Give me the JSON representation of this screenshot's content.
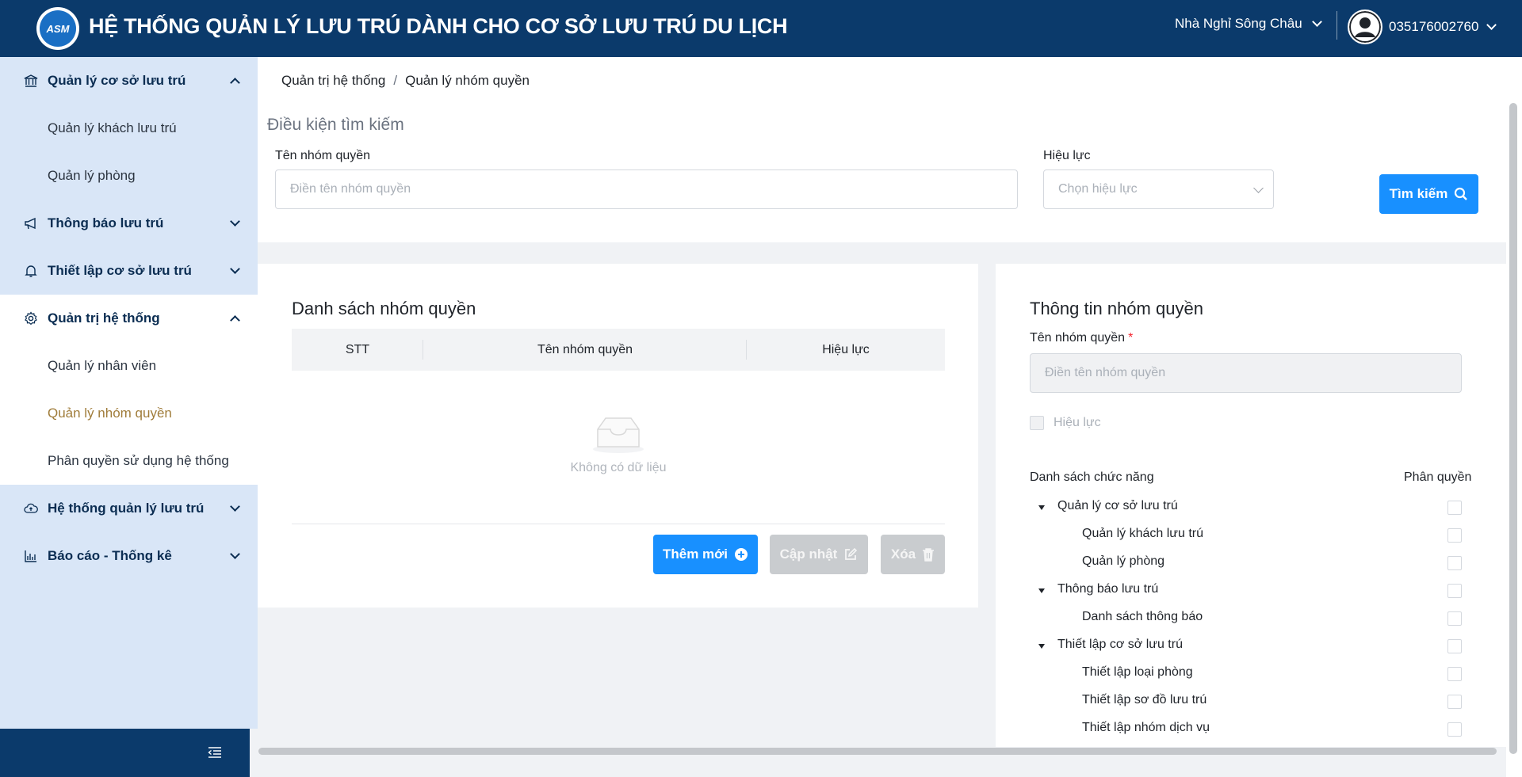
{
  "header": {
    "logo_text": "ASM",
    "title": "HỆ THỐNG QUẢN LÝ LƯU TRÚ DÀNH CHO CƠ SỞ LƯU TRÚ DU LỊCH",
    "facility": "Nhà Nghỉ Sông Châu",
    "user_phone": "035176002760"
  },
  "sidebar": {
    "items": [
      {
        "label": "Quản lý cơ sở lưu trú",
        "icon": "bank-icon",
        "expanded": true
      },
      {
        "label": "Quản lý khách lưu trú"
      },
      {
        "label": "Quản lý phòng"
      },
      {
        "label": "Thông báo lưu trú",
        "icon": "megaphone-icon",
        "expanded": false
      },
      {
        "label": "Thiết lập cơ sở lưu trú",
        "icon": "bell-icon",
        "expanded": false
      },
      {
        "label": "Quản trị hệ thống",
        "icon": "gear-icon",
        "expanded": true
      },
      {
        "label": "Quản lý nhân viên"
      },
      {
        "label": "Quản lý nhóm quyền",
        "active": true
      },
      {
        "label": "Phân quyền sử dụng hệ thống"
      },
      {
        "label": "Hệ thống quản lý lưu trú",
        "icon": "cloud-icon",
        "expanded": false
      },
      {
        "label": "Báo cáo - Thống kê",
        "icon": "bar-chart-icon",
        "expanded": false
      }
    ]
  },
  "breadcrumb": {
    "parent": "Quản trị hệ thống",
    "separator": "/",
    "current": "Quản lý nhóm quyền"
  },
  "search": {
    "title": "Điều kiện tìm kiếm",
    "name_label": "Tên nhóm quyền",
    "name_placeholder": "Điền tên nhóm quyền",
    "status_label": "Hiệu lực",
    "status_placeholder": "Chọn hiệu lực",
    "button": "Tìm kiếm"
  },
  "list": {
    "title": "Danh sách nhóm quyền",
    "columns": [
      "STT",
      "Tên nhóm quyền",
      "Hiệu lực"
    ],
    "empty_text": "Không có dữ liệu",
    "add_button": "Thêm mới",
    "update_button": "Cập nhật",
    "delete_button": "Xóa"
  },
  "detail": {
    "title": "Thông tin nhóm quyền",
    "name_label": "Tên nhóm quyền",
    "required_mark": "*",
    "name_placeholder": "Điền tên nhóm quyền",
    "active_label": "Hiệu lực",
    "functions_header": "Danh sách chức năng",
    "permission_header": "Phân quyền",
    "tree": [
      {
        "label": "Quản lý cơ sở lưu trú",
        "level": 0
      },
      {
        "label": "Quản lý khách lưu trú",
        "level": 1
      },
      {
        "label": "Quản lý phòng",
        "level": 1
      },
      {
        "label": "Thông báo lưu trú",
        "level": 0
      },
      {
        "label": "Danh sách thông báo",
        "level": 1
      },
      {
        "label": "Thiết lập cơ sở lưu trú",
        "level": 0
      },
      {
        "label": "Thiết lập loại phòng",
        "level": 1
      },
      {
        "label": "Thiết lập sơ đồ lưu trú",
        "level": 1
      },
      {
        "label": "Thiết lập nhóm dịch vụ",
        "level": 1
      }
    ]
  },
  "colors": {
    "header_bg": "#0b3a6b",
    "sidebar_bg": "#d9e6f7",
    "primary": "#1890ff",
    "active_item": "#a07c3a"
  }
}
